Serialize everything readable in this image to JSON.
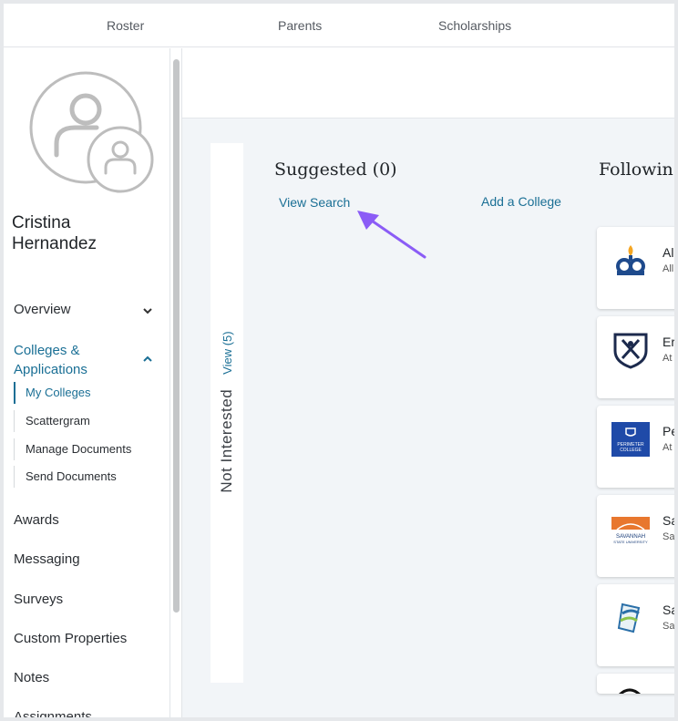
{
  "topnav": {
    "tabs": [
      "Roster",
      "Parents",
      "Scholarships"
    ]
  },
  "user": {
    "first_name": "Cristina",
    "last_name": "Hernandez"
  },
  "sidebar": {
    "overview": "Overview",
    "colleges_line1": "Colleges &",
    "colleges_line2": "Applications",
    "sub_items": [
      "My Colleges",
      "Scattergram",
      "Manage Documents",
      "Send Documents"
    ],
    "items": [
      "Awards",
      "Messaging",
      "Surveys",
      "Custom Properties",
      "Notes",
      "Assignments"
    ]
  },
  "not_interested": {
    "title": "Not Interested",
    "view_label": "View (5)"
  },
  "suggested": {
    "title": "Suggested (0)",
    "view_search": "View Search",
    "add_college": "Add a College"
  },
  "following": {
    "title": "Followin",
    "colleges": [
      {
        "name": "Al",
        "location": "All"
      },
      {
        "name": "Er",
        "location": "At"
      },
      {
        "name": "Pe",
        "location": "At"
      },
      {
        "name": "Sa",
        "location": "Sa"
      },
      {
        "name": "Sa",
        "location": "Sa"
      }
    ]
  },
  "logos": {
    "perimeter_line1": "PERIMETER",
    "perimeter_line2": "COLLEGE",
    "savannah_line1": "SAVANNAH",
    "savannah_line2": "STATE UNIVERSITY"
  },
  "colors": {
    "accent": "#1a6f95",
    "arrow": "#8b5cf6",
    "background": "#f2f5f8"
  }
}
